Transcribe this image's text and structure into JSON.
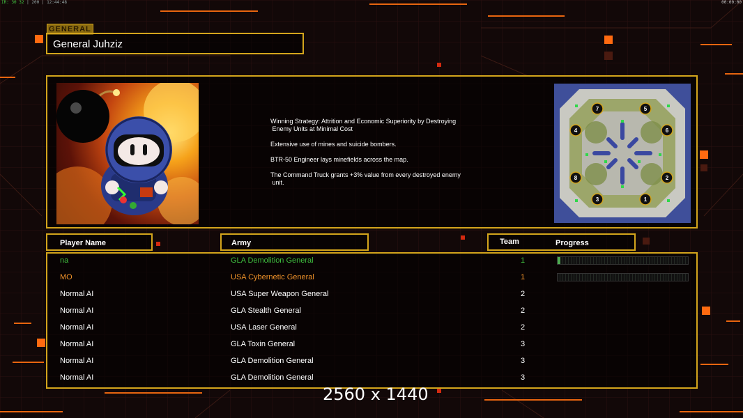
{
  "status_bar": {
    "left_fps": "IR: 30 32",
    "left_misc": "| 200 |",
    "left_time": "12:44:48",
    "right_time": "00:00:00"
  },
  "general": {
    "section_tag": "GENERAL",
    "name": "General Juhziz"
  },
  "strategy_lines": [
    "Winning Strategy: Attrition and Economic Superiority by Destroying\n Enemy Units at Minimal Cost",
    "Extensive use of mines and suicide bombers.",
    "BTR-50 Engineer lays minefields across the map.",
    "The Command Truck grants +3% value from every destroyed enemy\n unit."
  ],
  "minimap": {
    "start_positions": [
      "7",
      "5",
      "4",
      "6",
      "8",
      "2",
      "3",
      "1"
    ]
  },
  "table": {
    "headers": {
      "player": "Player Name",
      "army": "Army",
      "team": "Team",
      "progress": "Progress"
    },
    "rows": [
      {
        "name": "na",
        "army": "GLA Demolition General",
        "team": "1",
        "color": "#3fbf3f",
        "progress": 0.01
      },
      {
        "name": "MO",
        "army": "USA Cybernetic General",
        "team": "1",
        "color": "#f0922a",
        "progress": 0.0
      },
      {
        "name": "Normal AI",
        "army": "USA Super Weapon General",
        "team": "2",
        "color": "#ffffff"
      },
      {
        "name": "Normal AI",
        "army": "GLA Stealth General",
        "team": "2",
        "color": "#ffffff"
      },
      {
        "name": "Normal AI",
        "army": "USA Laser General",
        "team": "2",
        "color": "#ffffff"
      },
      {
        "name": "Normal AI",
        "army": "GLA Toxin General",
        "team": "3",
        "color": "#ffffff"
      },
      {
        "name": "Normal AI",
        "army": "GLA Demolition General",
        "team": "3",
        "color": "#ffffff"
      },
      {
        "name": "Normal AI",
        "army": "GLA Demolition General",
        "team": "3",
        "color": "#ffffff"
      }
    ]
  },
  "resolution_label": "2560 x 1440",
  "colors": {
    "gold": "#d4a51c",
    "accent_orange": "#ff6a10"
  }
}
